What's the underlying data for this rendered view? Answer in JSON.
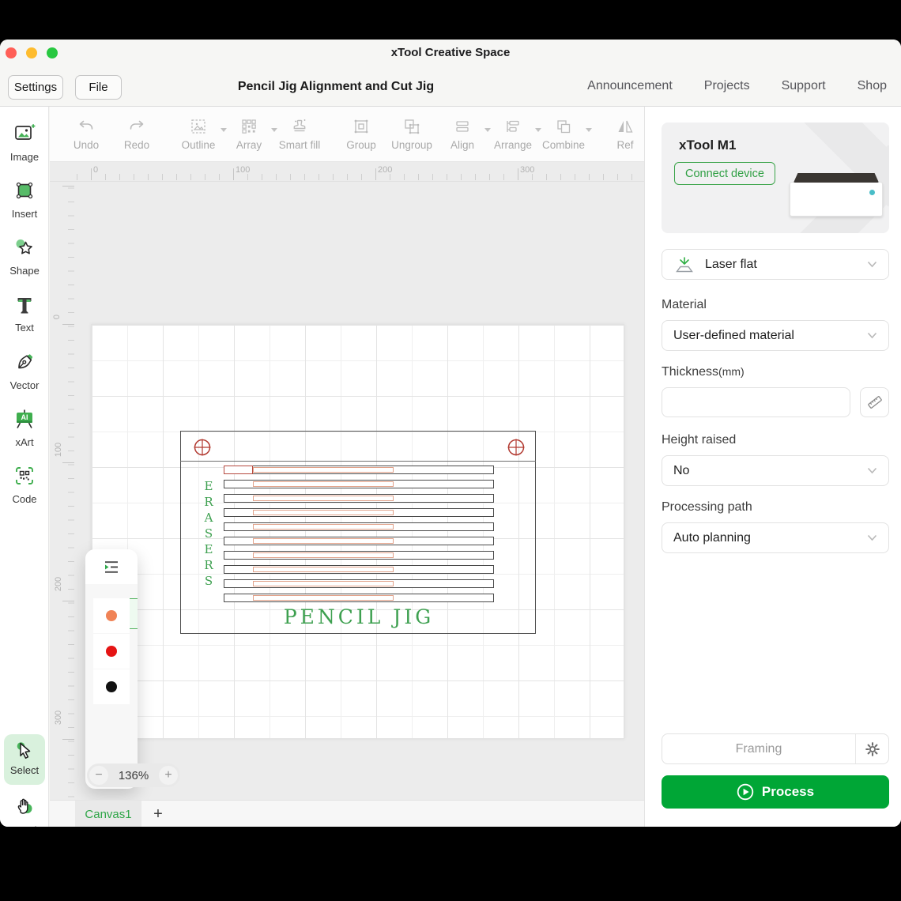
{
  "window": {
    "title": "xTool Creative Space"
  },
  "header": {
    "settings_label": "Settings",
    "file_label": "File",
    "doc_title": "Pencil Jig Alignment and Cut Jig",
    "nav": [
      {
        "label": "Announcement"
      },
      {
        "label": "Projects"
      },
      {
        "label": "Support"
      },
      {
        "label": "Shop"
      }
    ]
  },
  "toolbar": {
    "items": [
      {
        "label": "Undo"
      },
      {
        "label": "Redo"
      },
      {
        "label": "Outline"
      },
      {
        "label": "Array"
      },
      {
        "label": "Smart fill"
      },
      {
        "label": "Group"
      },
      {
        "label": "Ungroup"
      },
      {
        "label": "Align"
      },
      {
        "label": "Arrange"
      },
      {
        "label": "Combine"
      },
      {
        "label": "Ref"
      }
    ]
  },
  "sidebar": {
    "items": [
      {
        "label": "Image"
      },
      {
        "label": "Insert"
      },
      {
        "label": "Shape"
      },
      {
        "label": "Text"
      },
      {
        "label": "Vector"
      },
      {
        "label": "xArt"
      },
      {
        "label": "Code"
      }
    ],
    "select_label": "Select",
    "hand_label": "Hand"
  },
  "canvas": {
    "ruler_x": [
      "0",
      "100",
      "200",
      "300"
    ],
    "ruler_y": [
      "0",
      "100",
      "200",
      "300"
    ],
    "zoom_level": "136%",
    "zoom_out": "−",
    "zoom_in": "+",
    "tab_label": "Canvas1",
    "tab_add": "+",
    "design": {
      "vertical_text": "ERASERS",
      "bottom_text": "PENCIL JIG",
      "slot_count": 10,
      "slot_stroke": "#4a4a4a",
      "inner_slot_stroke": "#e2a28a",
      "lead_slot_stroke": "#b5493f",
      "registration_mark_color": "#b23a31",
      "text_color": "#3ea050"
    },
    "palette": {
      "selected": 0,
      "colors": [
        "#1ea93c",
        "#f08356",
        "#e51414",
        "#111111"
      ]
    }
  },
  "panel": {
    "device": {
      "name": "xTool M1",
      "connect_label": "Connect device"
    },
    "processing_mode": {
      "value": "Laser flat"
    },
    "material": {
      "label": "Material",
      "value": "User-defined material"
    },
    "thickness": {
      "label": "Thickness",
      "unit": "(mm)",
      "value": ""
    },
    "height_raised": {
      "label": "Height raised",
      "value": "No"
    },
    "processing_path": {
      "label": "Processing path",
      "value": "Auto planning"
    },
    "framing_label": "Framing",
    "process_label": "Process"
  },
  "colors": {
    "accent_green": "#00a636",
    "connect_green": "#2f9f43",
    "select_highlight": "#d9f1dd",
    "traffic_red": "#ff5f57",
    "traffic_yellow": "#febc2e",
    "traffic_green": "#28c840"
  }
}
